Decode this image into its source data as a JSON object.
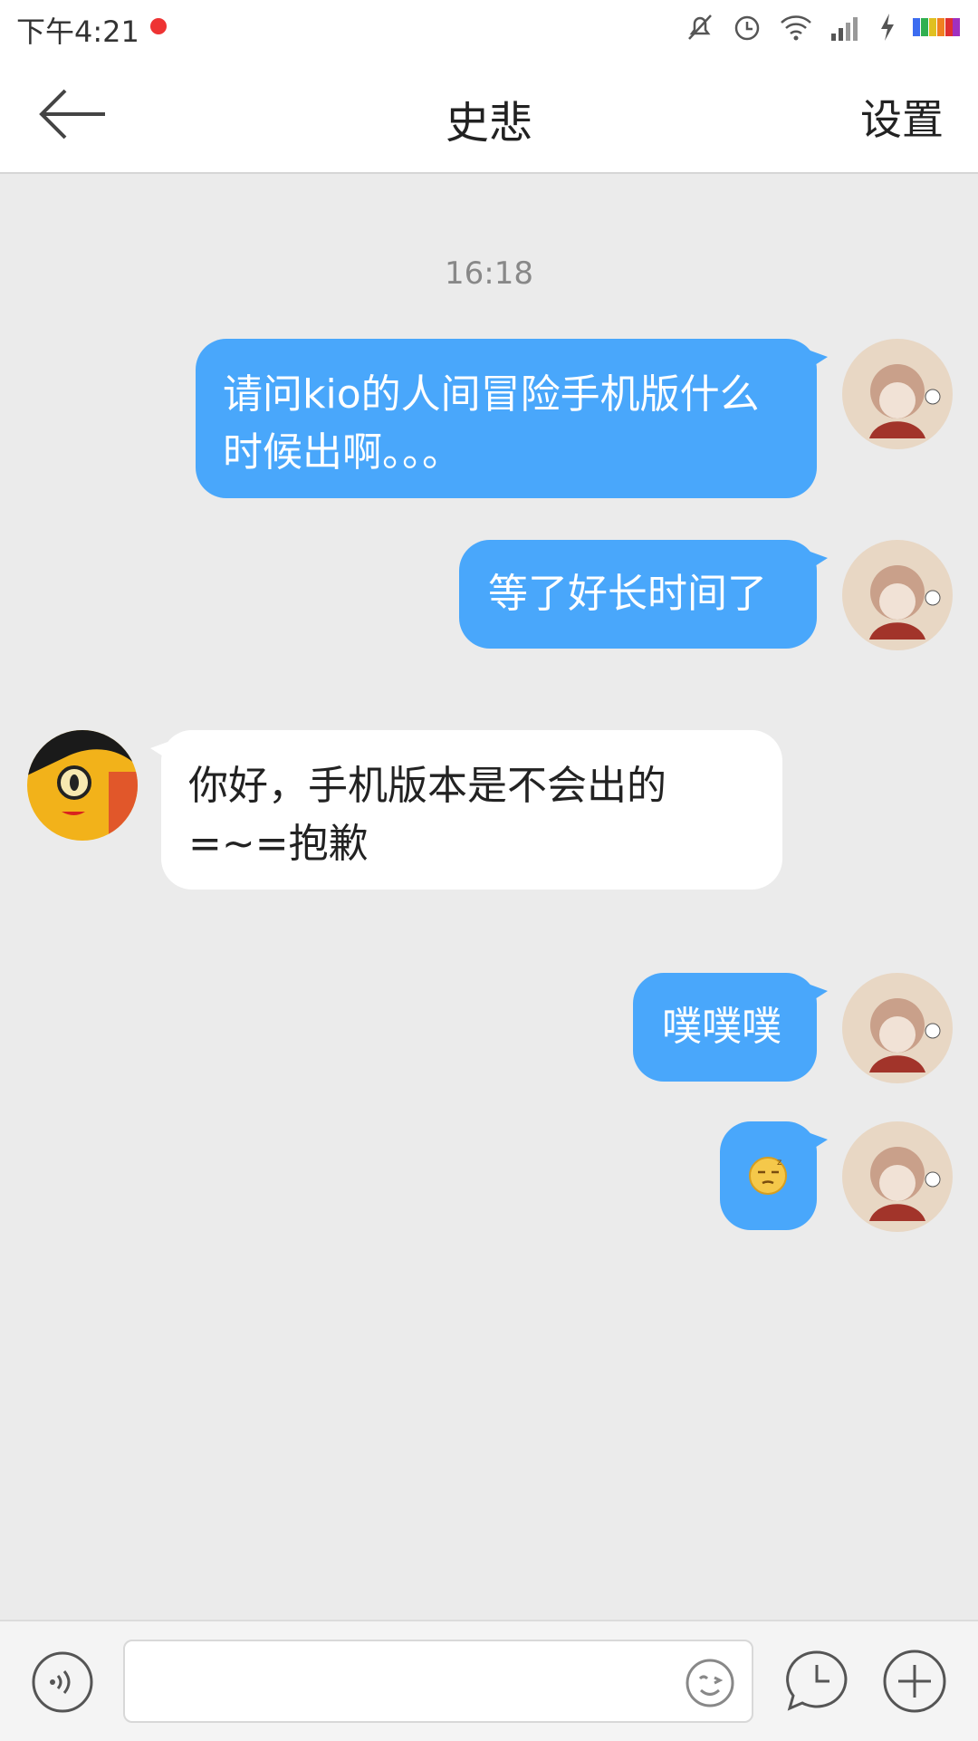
{
  "status": {
    "time": "下午4:21"
  },
  "header": {
    "title": "史悲",
    "settings": "设置"
  },
  "chat": {
    "timestamp": "16:18",
    "messages": [
      {
        "from": "me",
        "text": "请问kio的人间冒险手机版什么时候出啊。。。"
      },
      {
        "from": "me",
        "text": "等了好长时间了"
      },
      {
        "from": "other",
        "text": "你好，手机版本是不会出的=~=抱歉"
      },
      {
        "from": "me",
        "text": "噗噗噗"
      },
      {
        "from": "me",
        "emoji": "sleepy-emoji"
      }
    ]
  },
  "colors": {
    "bubble_me": "#49a7fb",
    "background": "#ebebeb"
  }
}
